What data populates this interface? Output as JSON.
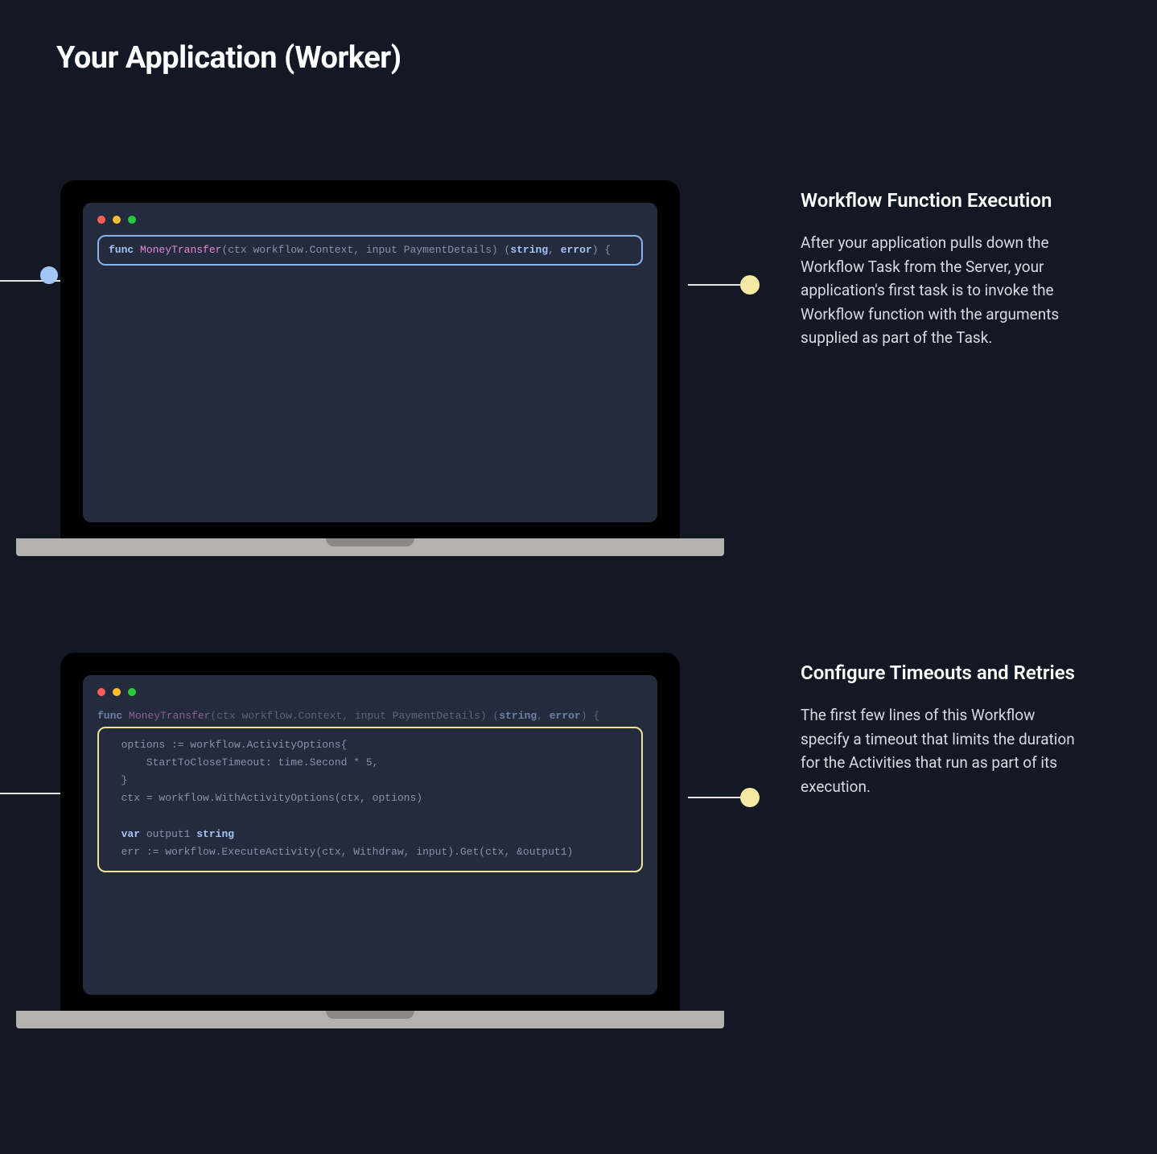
{
  "title": "Your Application (Worker)",
  "sections": [
    {
      "heading": "Workflow Function Execution",
      "body": "After your application pulls down the Workflow Task from the Server, your application's first task is to invoke the Workflow function with the arguments supplied as part of the Task.",
      "highlight_color": "blue",
      "show_incoming_dot": true,
      "code": {
        "signature": {
          "kw1": "func",
          "fn": "MoneyTransfer",
          "params": "(ctx workflow.Context, input PaymentDetails) (",
          "ret1": "string",
          "mid": ", ",
          "ret2": "error",
          "tail": ") {"
        }
      }
    },
    {
      "heading": "Configure Timeouts and Retries",
      "body": "The first few lines of this Workflow specify a timeout that limits the duration for the Activities that run as part of its execution.",
      "highlight_color": "yellow",
      "show_incoming_dot": false,
      "code": {
        "signature": {
          "kw1": "func",
          "fn": "MoneyTransfer",
          "params": "(ctx workflow.Context, input PaymentDetails) (",
          "ret1": "string",
          "mid": ", ",
          "ret2": "error",
          "tail": ") {"
        },
        "body_lines": [
          {
            "indent": "  ",
            "text": "options := workflow.ActivityOptions{"
          },
          {
            "indent": "      ",
            "text": "StartToCloseTimeout: time.Second * 5,"
          },
          {
            "indent": "  ",
            "text": "}"
          },
          {
            "indent": "  ",
            "text": "ctx = workflow.WithActivityOptions(ctx, options)"
          },
          {
            "indent": "",
            "text": ""
          },
          {
            "indent": "  ",
            "kw": "var",
            "rest": " output1 ",
            "kw2": "string"
          },
          {
            "indent": "  ",
            "text": "err := workflow.ExecuteActivity(ctx, Withdraw, input).Get(ctx, &output1)"
          }
        ]
      }
    }
  ]
}
